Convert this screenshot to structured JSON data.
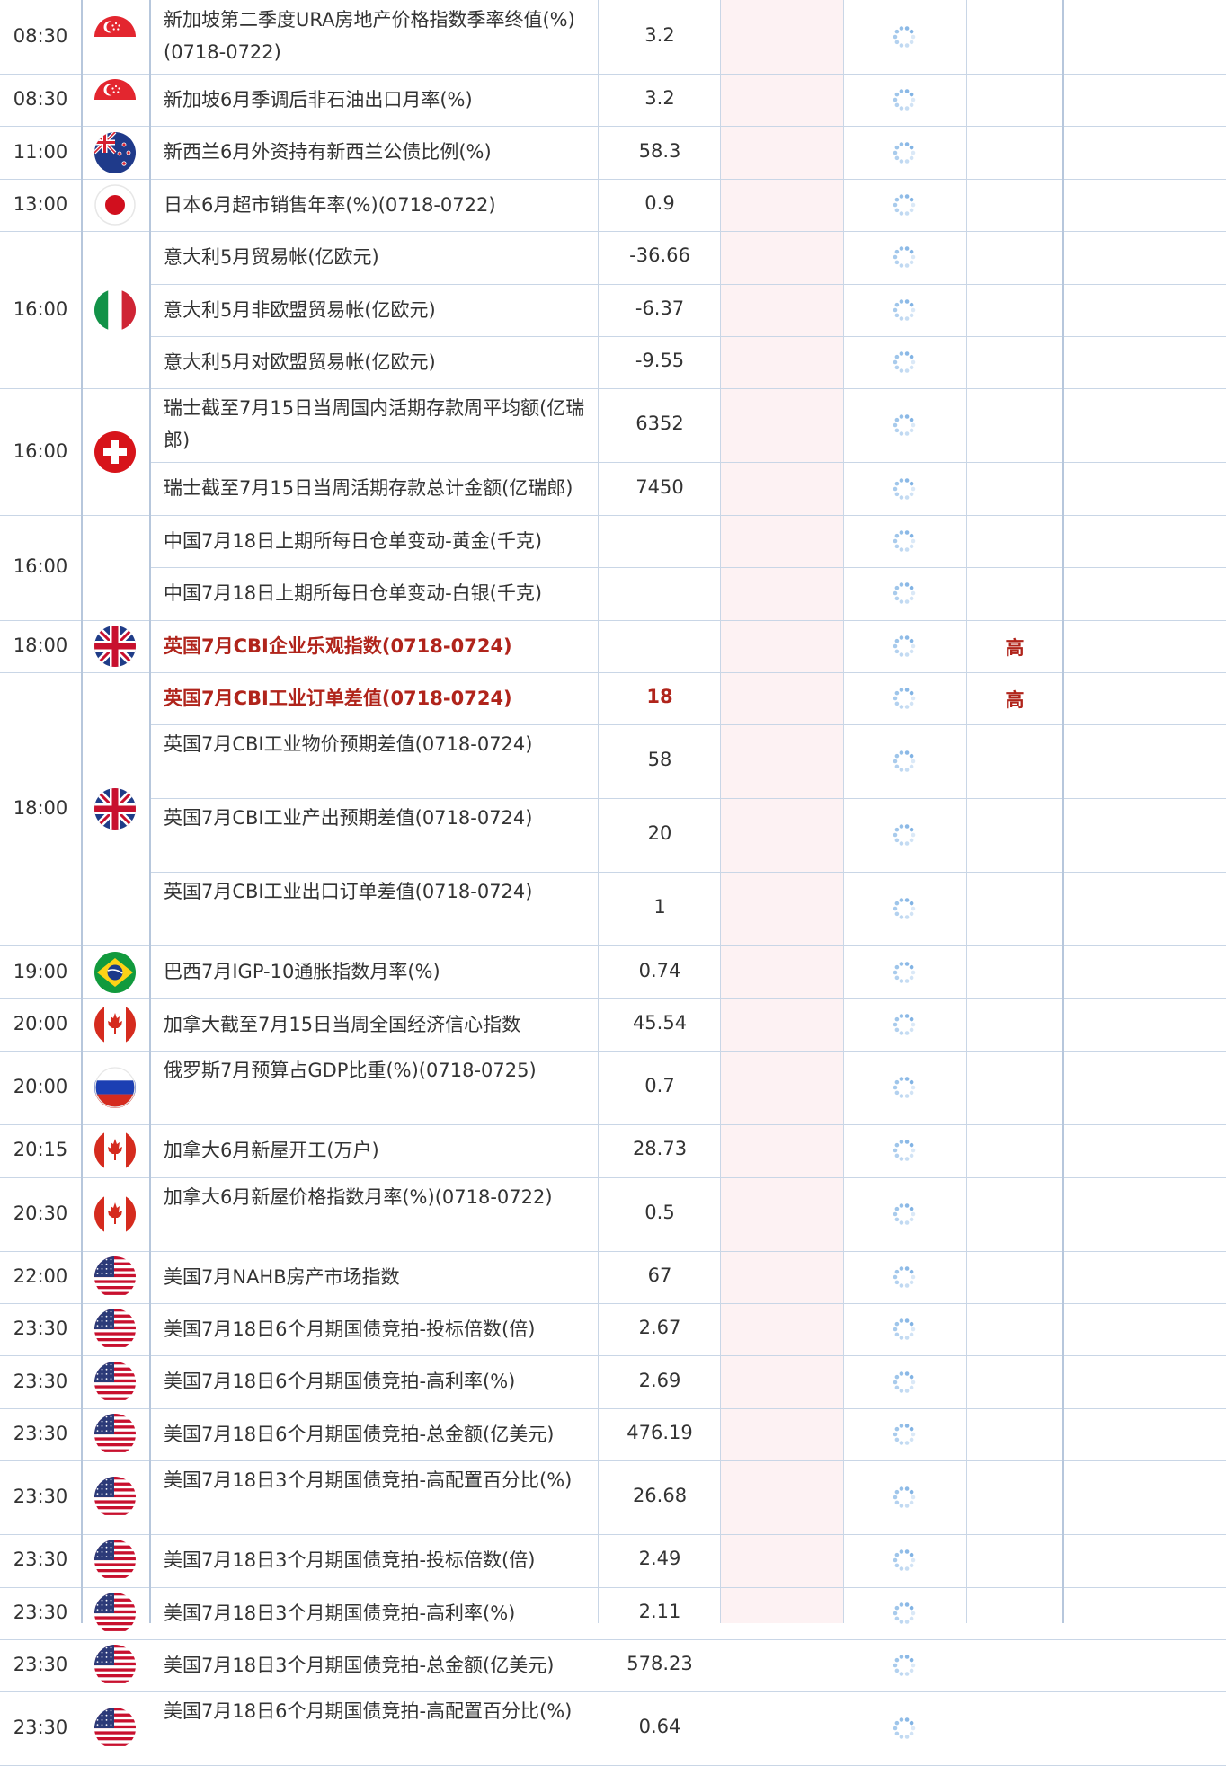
{
  "colors": {
    "important_text": "#b0241b",
    "grid": "#c9d6e6",
    "pink_column": "#fdf2f3"
  },
  "groups": [
    {
      "time": "08:30",
      "flag": "singapore-flag",
      "rows": [
        {
          "name": "新加坡第二季度URA房地产价格指数季率终值(%)(0718-0722)",
          "value": "3.2",
          "important": false,
          "importance": ""
        }
      ]
    },
    {
      "time": "08:30",
      "flag": "singapore-flag",
      "rows": [
        {
          "name": "新加坡6月季调后非石油出口月率(%)",
          "value": "3.2",
          "important": false,
          "importance": ""
        }
      ]
    },
    {
      "time": "11:00",
      "flag": "new-zealand-flag",
      "rows": [
        {
          "name": "新西兰6月外资持有新西兰公债比例(%)",
          "value": "58.3",
          "important": false,
          "importance": ""
        }
      ]
    },
    {
      "time": "13:00",
      "flag": "japan-flag",
      "rows": [
        {
          "name": "日本6月超市销售年率(%)(0718-0722)",
          "value": "0.9",
          "important": false,
          "importance": ""
        }
      ]
    },
    {
      "time": "16:00",
      "flag": "italy-flag",
      "rows": [
        {
          "name": "意大利5月贸易帐(亿欧元)",
          "value": "-36.66",
          "important": false,
          "importance": ""
        },
        {
          "name": "意大利5月非欧盟贸易帐(亿欧元)",
          "value": "-6.37",
          "important": false,
          "importance": ""
        },
        {
          "name": "意大利5月对欧盟贸易帐(亿欧元)",
          "value": "-9.55",
          "important": false,
          "importance": ""
        }
      ]
    },
    {
      "time": "16:00",
      "flag": "switzerland-flag",
      "rows": [
        {
          "name": "瑞士截至7月15日当周国内活期存款周平均额(亿瑞郎)",
          "value": "6352",
          "important": false,
          "importance": ""
        },
        {
          "name": "瑞士截至7月15日当周活期存款总计金额(亿瑞郎)",
          "value": "7450",
          "important": false,
          "importance": ""
        }
      ]
    },
    {
      "time": "16:00",
      "flag": "",
      "rows": [
        {
          "name": "中国7月18日上期所每日仓单变动-黄金(千克)",
          "value": "",
          "important": false,
          "importance": ""
        },
        {
          "name": "中国7月18日上期所每日仓单变动-白银(千克)",
          "value": "",
          "important": false,
          "importance": ""
        }
      ]
    },
    {
      "time": "18:00",
      "flag": "uk-flag",
      "rows": [
        {
          "name": "英国7月CBI企业乐观指数(0718-0724)",
          "value": "",
          "important": true,
          "importance": "高"
        }
      ]
    },
    {
      "time": "18:00",
      "flag": "uk-flag",
      "rows": [
        {
          "name": "英国7月CBI工业订单差值(0718-0724)",
          "value": "18",
          "important": true,
          "importance": "高"
        },
        {
          "name": "英国7月CBI工业物价预期差值(0718-0724)",
          "value": "58",
          "important": false,
          "importance": ""
        },
        {
          "name": "英国7月CBI工业产出预期差值(0718-0724)",
          "value": "20",
          "important": false,
          "importance": ""
        },
        {
          "name": "英国7月CBI工业出口订单差值(0718-0724)",
          "value": "1",
          "important": false,
          "importance": ""
        }
      ]
    },
    {
      "time": "19:00",
      "flag": "brazil-flag",
      "rows": [
        {
          "name": "巴西7月IGP-10通胀指数月率(%)",
          "value": "0.74",
          "important": false,
          "importance": ""
        }
      ]
    },
    {
      "time": "20:00",
      "flag": "canada-flag",
      "rows": [
        {
          "name": "加拿大截至7月15日当周全国经济信心指数",
          "value": "45.54",
          "important": false,
          "importance": ""
        }
      ]
    },
    {
      "time": "20:00",
      "flag": "russia-flag",
      "rows": [
        {
          "name": "俄罗斯7月预算占GDP比重(%)(0718-0725)",
          "value": "0.7",
          "important": false,
          "importance": ""
        }
      ]
    },
    {
      "time": "20:15",
      "flag": "canada-flag",
      "rows": [
        {
          "name": "加拿大6月新屋开工(万户)",
          "value": "28.73",
          "important": false,
          "importance": ""
        }
      ]
    },
    {
      "time": "20:30",
      "flag": "canada-flag",
      "rows": [
        {
          "name": "加拿大6月新屋价格指数月率(%)(0718-0722)",
          "value": "0.5",
          "important": false,
          "importance": ""
        }
      ]
    },
    {
      "time": "22:00",
      "flag": "usa-flag",
      "rows": [
        {
          "name": "美国7月NAHB房产市场指数",
          "value": "67",
          "important": false,
          "importance": ""
        }
      ]
    },
    {
      "time": "23:30",
      "flag": "usa-flag",
      "rows": [
        {
          "name": "美国7月18日6个月期国债竞拍-投标倍数(倍)",
          "value": "2.67",
          "important": false,
          "importance": ""
        }
      ]
    },
    {
      "time": "23:30",
      "flag": "usa-flag",
      "rows": [
        {
          "name": "美国7月18日6个月期国债竞拍-高利率(%)",
          "value": "2.69",
          "important": false,
          "importance": ""
        }
      ]
    },
    {
      "time": "23:30",
      "flag": "usa-flag",
      "rows": [
        {
          "name": "美国7月18日6个月期国债竞拍-总金额(亿美元)",
          "value": "476.19",
          "important": false,
          "importance": ""
        }
      ]
    },
    {
      "time": "23:30",
      "flag": "usa-flag",
      "rows": [
        {
          "name": "美国7月18日3个月期国债竞拍-高配置百分比(%)",
          "value": "26.68",
          "important": false,
          "importance": ""
        }
      ]
    },
    {
      "time": "23:30",
      "flag": "usa-flag",
      "rows": [
        {
          "name": "美国7月18日3个月期国债竞拍-投标倍数(倍)",
          "value": "2.49",
          "important": false,
          "importance": ""
        }
      ]
    },
    {
      "time": "23:30",
      "flag": "usa-flag",
      "rows": [
        {
          "name": "美国7月18日3个月期国债竞拍-高利率(%)",
          "value": "2.11",
          "important": false,
          "importance": ""
        }
      ]
    },
    {
      "time": "23:30",
      "flag": "usa-flag",
      "rows": [
        {
          "name": "美国7月18日3个月期国债竞拍-总金额(亿美元)",
          "value": "578.23",
          "important": false,
          "importance": ""
        }
      ]
    },
    {
      "time": "23:30",
      "flag": "usa-flag",
      "rows": [
        {
          "name": "美国7月18日6个月期国债竞拍-高配置百分比(%)",
          "value": "0.64",
          "important": false,
          "importance": ""
        }
      ]
    }
  ]
}
